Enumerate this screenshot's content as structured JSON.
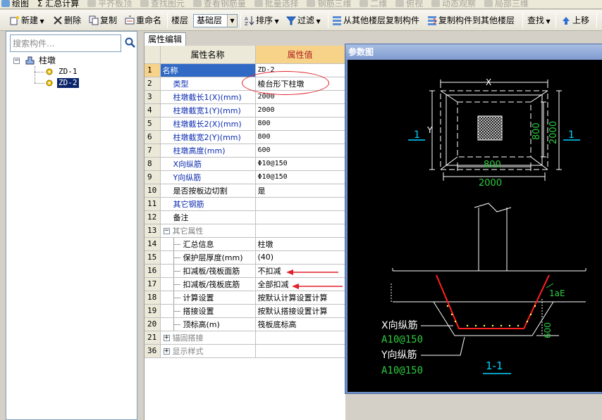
{
  "topbar": {
    "items": [
      {
        "label": "绘图",
        "disabled": false
      },
      {
        "label": "Σ 汇总计算",
        "disabled": false
      },
      {
        "label": "平齐板顶",
        "disabled": true
      },
      {
        "label": "查找图元",
        "disabled": true
      },
      {
        "label": "查看钢筋量",
        "disabled": true
      },
      {
        "label": "批量选择",
        "disabled": true
      },
      {
        "label": "钢筋三维",
        "disabled": true
      },
      {
        "label": "二维",
        "disabled": true
      },
      {
        "label": "俯视",
        "disabled": true
      },
      {
        "label": "动态观察",
        "disabled": true
      },
      {
        "label": "局部三维",
        "disabled": true
      }
    ]
  },
  "toolbar": {
    "new_label": "新建",
    "delete_label": "删除",
    "copy_label": "复制",
    "rename_label": "重命名",
    "floor_label": "楼层",
    "floor_value": "基础层",
    "sort_label": "排序",
    "filter_label": "过滤",
    "copy_from_label": "从其他楼层复制构件",
    "copy_to_label": "复制构件到其他楼层",
    "find_label": "查找",
    "move_up_label": "上移"
  },
  "left_panel": {
    "search_placeholder": "搜索构件...",
    "tree_root": "柱墩",
    "tree_children": [
      "ZD-1",
      "ZD-2"
    ],
    "selected_index": 1
  },
  "editor": {
    "tab_label": "属性编辑",
    "col_name": "属性名称",
    "col_value": "属性值",
    "rows": [
      {
        "num": "1",
        "name": "名称",
        "value": "ZD-2"
      },
      {
        "num": "2",
        "name": "类型",
        "value": "棱台形下柱墩"
      },
      {
        "num": "3",
        "name": "柱墩截长1(X)(mm)",
        "value": "2000"
      },
      {
        "num": "4",
        "name": "柱墩截宽1(Y)(mm)",
        "value": "2000"
      },
      {
        "num": "5",
        "name": "柱墩截长2(X)(mm)",
        "value": "800"
      },
      {
        "num": "6",
        "name": "柱墩截宽2(Y)(mm)",
        "value": "800"
      },
      {
        "num": "7",
        "name": "柱墩高度(mm)",
        "value": "600"
      },
      {
        "num": "8",
        "name": "X向纵筋",
        "value": "Φ10@150"
      },
      {
        "num": "9",
        "name": "Y向纵筋",
        "value": "Φ10@150"
      },
      {
        "num": "10",
        "name": "是否按板边切割",
        "value": "是"
      },
      {
        "num": "11",
        "name": "其它钢筋",
        "value": ""
      },
      {
        "num": "12",
        "name": "备注",
        "value": ""
      },
      {
        "num": "13",
        "name": "其它属性",
        "value": ""
      },
      {
        "num": "14",
        "name": "汇总信息",
        "value": "柱墩"
      },
      {
        "num": "15",
        "name": "保护层厚度(mm)",
        "value": "(40)"
      },
      {
        "num": "16",
        "name": "扣减板/筏板面筋",
        "value": "不扣减"
      },
      {
        "num": "17",
        "name": "扣减板/筏板底筋",
        "value": "全部扣减"
      },
      {
        "num": "18",
        "name": "计算设置",
        "value": "按默认计算设置计算"
      },
      {
        "num": "19",
        "name": "搭接设置",
        "value": "按默认搭接设置计算"
      },
      {
        "num": "20",
        "name": "顶标高(m)",
        "value": "筏板底标高"
      },
      {
        "num": "21",
        "name": "锚固搭接",
        "value": ""
      },
      {
        "num": "36",
        "name": "显示样式",
        "value": ""
      }
    ]
  },
  "figure": {
    "title": "参数图",
    "labels": {
      "x": "X",
      "y": "Y",
      "section_left": "1",
      "section_right": "1",
      "dim_800_bottom": "800",
      "dim_2000_bottom": "2000",
      "dim_800_right": "800",
      "dim_2000_right": "2000",
      "lae": "1aE",
      "dim_600": "600",
      "x_rebar": "X向纵筋",
      "x_rebar_spec": "A10@150",
      "y_rebar": "Y向纵筋",
      "y_rebar_spec": "A10@150",
      "section_name": "1-1"
    }
  },
  "colors": {
    "accent": "#316ac5",
    "header_value_bg": "#f7d389",
    "annotation_red": "#e0202a",
    "cad_green": "#2ecc40",
    "cad_cyan": "#00d4ff",
    "cad_red": "#ff2020"
  }
}
